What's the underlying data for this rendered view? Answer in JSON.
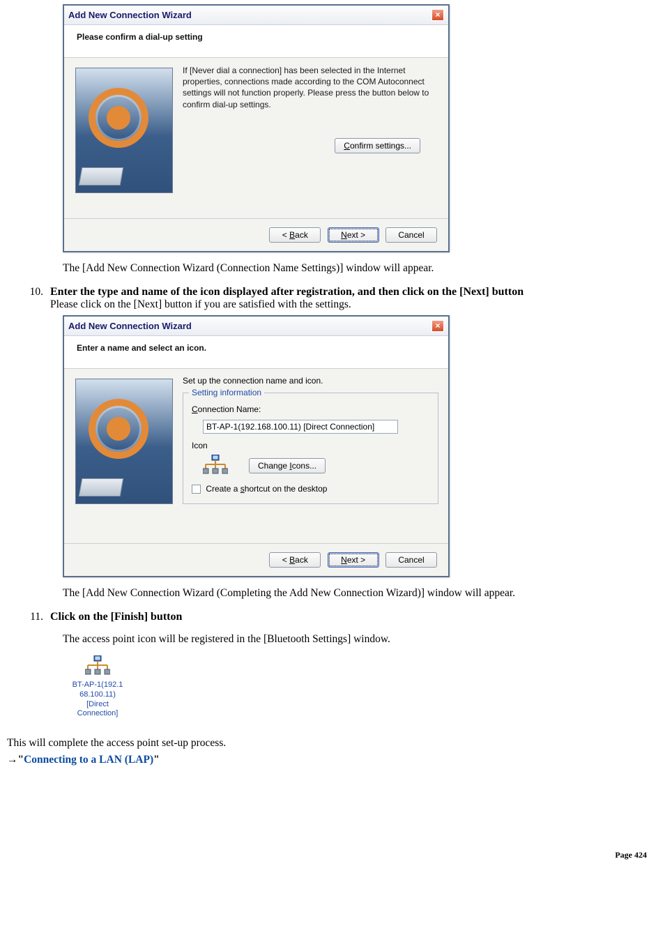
{
  "wizard1": {
    "title": "Add New Connection Wizard",
    "subtitle": "Please confirm a dial-up setting",
    "body_text": "If [Never dial a connection] has been selected in the Internet properties, connections made according to the COM Autoconnect settings will not function properly. Please press the button below to confirm dial-up settings.",
    "confirm_button": "Confirm settings...",
    "back": "< Back",
    "next": "Next >",
    "cancel": "Cancel"
  },
  "para1": "The [Add New Connection Wizard (Connection Name Settings)] window will appear.",
  "step10": {
    "number": "10.",
    "bold": "Enter the type and name of the icon displayed after registration, and then click on the [Next] button",
    "line2": "Please click on the [Next] button if you are satisfied with the settings."
  },
  "wizard2": {
    "title": "Add New Connection Wizard",
    "subtitle": "Enter a name and select an icon.",
    "top_text": "Set up the connection name and icon.",
    "legend": "Setting information",
    "conn_label": "Connection Name:",
    "conn_value": "BT-AP-1(192.168.100.11) [Direct Connection]",
    "icon_label": "Icon",
    "change_icons": "Change Icons...",
    "shortcut": "Create a shortcut on the desktop",
    "back": "< Back",
    "next": "Next >",
    "cancel": "Cancel"
  },
  "para2": "The [Add New Connection Wizard (Completing the Add New Connection Wizard)] window will appear.",
  "step11": {
    "number": "11.",
    "bold": "Click on the [Finish] button"
  },
  "para3": "The access point icon will be registered in the [Bluetooth Settings] window.",
  "ap_icon": {
    "line1": "BT-AP-1(192.1",
    "line2": "68.100.11)",
    "line3": "[Direct",
    "line4": "Connection]"
  },
  "footer1": "This will complete the access point set-up process.",
  "arrow": "→",
  "quote": "\"",
  "link_text": "Connecting to a LAN (LAP)",
  "page_label": "Page 424"
}
